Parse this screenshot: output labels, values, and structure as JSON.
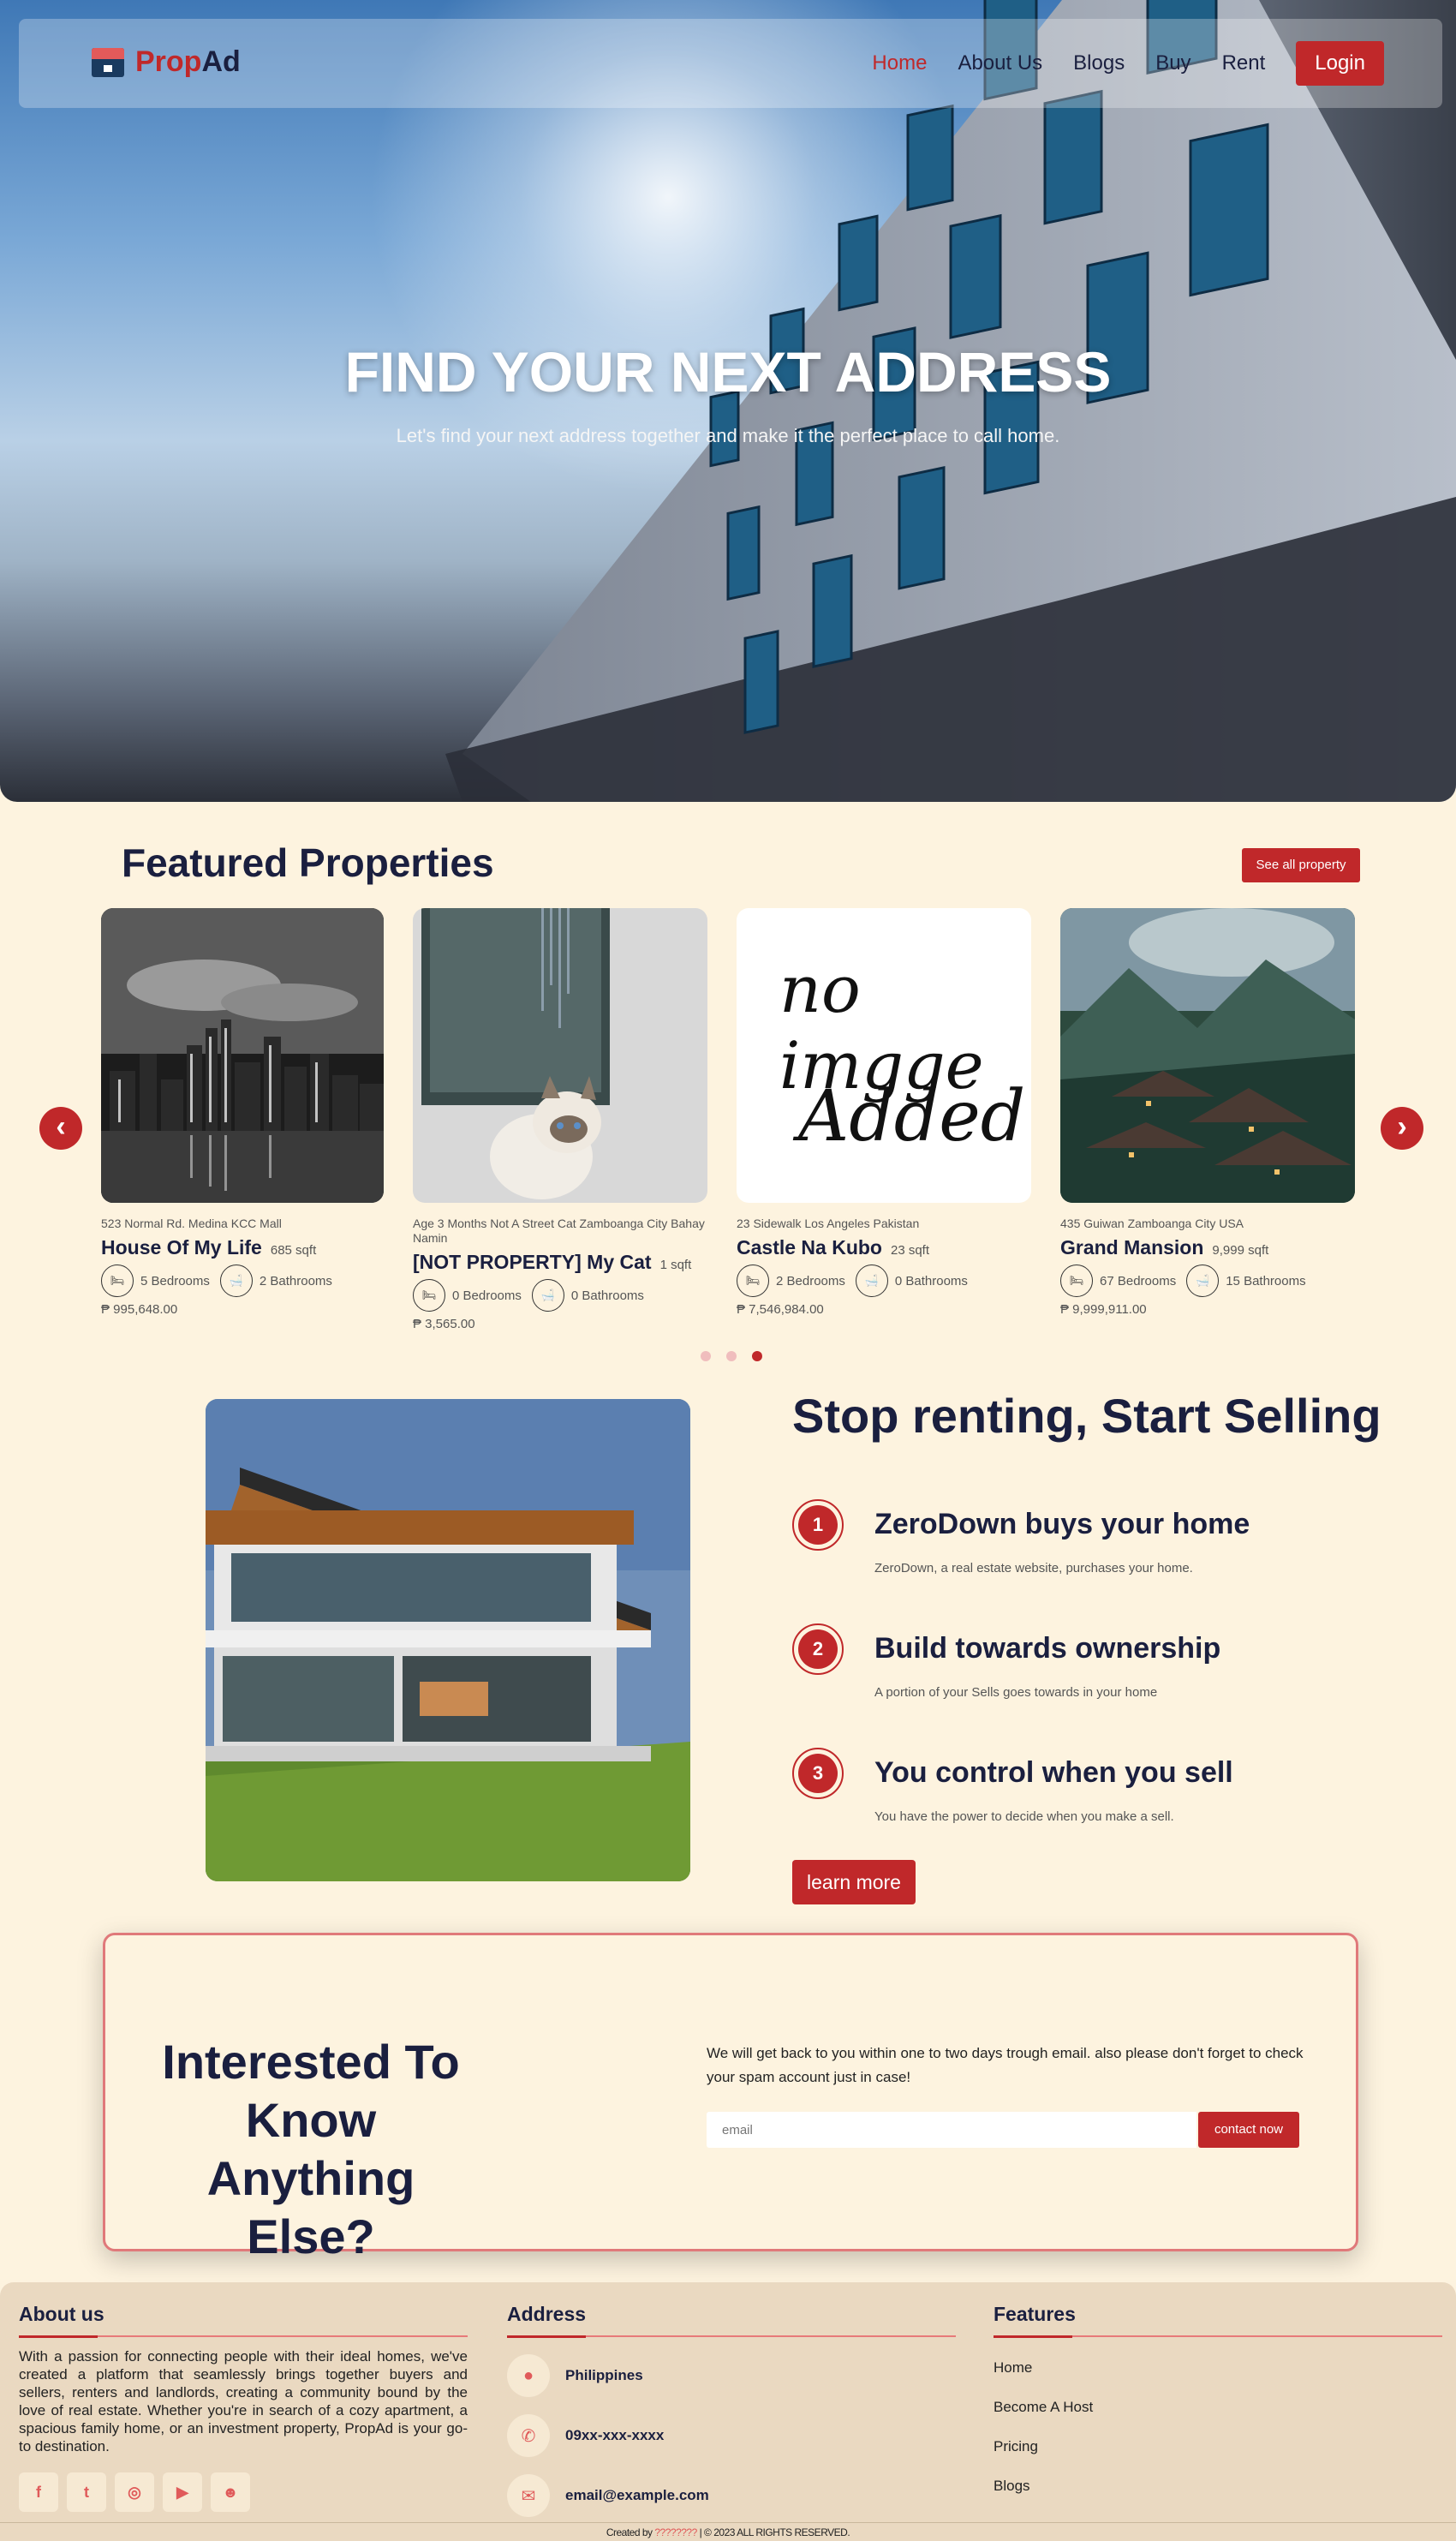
{
  "nav": {
    "brand_part1": "Prop",
    "brand_part2": "Ad",
    "links": [
      "Home",
      "About Us",
      "Blogs",
      "Buy",
      "Rent"
    ],
    "login": "Login"
  },
  "hero": {
    "title": "FIND YOUR NEXT ADDRESS",
    "subtitle": "Let's find your next address together and make it the perfect place to call home."
  },
  "featured": {
    "title": "Featured Properties",
    "see_all": "See all property",
    "cards": [
      {
        "address": "523 Normal Rd. Medina KCC Mall",
        "name": "House Of My Life",
        "sqft": "685 sqft",
        "bedrooms": "5 Bedrooms",
        "bathrooms": "2 Bathrooms",
        "price": "₱ 995,648.00"
      },
      {
        "address": "Age 3 Months Not A Street Cat Zamboanga City Bahay Namin",
        "name": "[NOT PROPERTY] My Cat",
        "sqft": "1 sqft",
        "bedrooms": "0 Bedrooms",
        "bathrooms": "0 Bathrooms",
        "price": "₱ 3,565.00"
      },
      {
        "address": "23 Sidewalk Los Angeles Pakistan",
        "name": "Castle Na Kubo",
        "sqft": "23 sqft",
        "bedrooms": "2 Bedrooms",
        "bathrooms": "0 Bathrooms",
        "price": "₱ 7,546,984.00",
        "image_text_1": "no imgge",
        "image_text_2": "Added"
      },
      {
        "address": "435 Guiwan Zamboanga City USA",
        "name": "Grand Mansion",
        "sqft": "9,999 sqft",
        "bedrooms": "67 Bedrooms",
        "bathrooms": "15 Bathrooms",
        "price": "₱ 9,999,911.00"
      }
    ]
  },
  "selling": {
    "title": "Stop renting, Start Selling",
    "steps": [
      {
        "num": "1",
        "title": "ZeroDown buys your home",
        "desc": "ZeroDown, a real estate website, purchases your home."
      },
      {
        "num": "2",
        "title": "Build towards ownership",
        "desc": "A portion of your Sells goes towards in your home"
      },
      {
        "num": "3",
        "title": "You control when you sell",
        "desc": "You have the power to decide when you make a sell."
      }
    ],
    "button": "learn more"
  },
  "contact": {
    "title": "Interested To Know Anything Else?",
    "text": "We will get back to you within one to two days trough email. also please don't forget to check your spam account just in case!",
    "email_placeholder": "email",
    "button": "contact now"
  },
  "footer": {
    "about_title": "About us",
    "about_text": "With a passion for connecting people with their ideal homes, we've created a platform that seamlessly brings together buyers and sellers, renters and landlords, creating a community bound by the love of real estate. Whether you're in search of a cozy apartment, a spacious family home, or an investment property, PropAd is your go-to destination.",
    "socials": [
      "facebook-icon",
      "twitter-icon",
      "instagram-icon",
      "youtube-icon",
      "discord-icon"
    ],
    "address_title": "Address",
    "address_items": [
      "Philippines",
      "09xx-xxx-xxxx",
      "email@example.com"
    ],
    "features_title": "Features",
    "features": [
      "Home",
      "Become A Host",
      "Pricing",
      "Blogs"
    ],
    "credit_prefix": "Created by",
    "credit_name": "????????",
    "credit_suffix": "| © 2023 ALL RIGHTS RESERVED."
  },
  "colors": {
    "accent": "#c0282a",
    "navy": "#1a1f3f",
    "cream": "#fdf3df",
    "footer": "#ead9c1"
  }
}
